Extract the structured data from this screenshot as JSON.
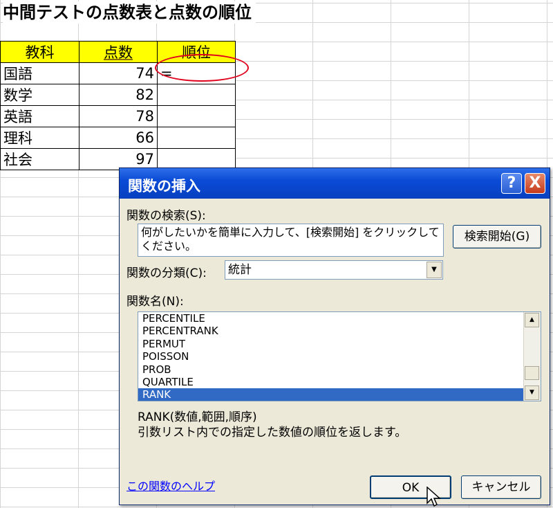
{
  "sheet": {
    "title": "中間テストの点数表と点数の順位",
    "headers": [
      "教科",
      "点数",
      "順位"
    ],
    "rows": [
      {
        "subject": "国語",
        "score": "74",
        "rank": "="
      },
      {
        "subject": "数学",
        "score": "82",
        "rank": ""
      },
      {
        "subject": "英語",
        "score": "78",
        "rank": ""
      },
      {
        "subject": "理科",
        "score": "66",
        "rank": ""
      },
      {
        "subject": "社会",
        "score": "97",
        "rank": ""
      }
    ]
  },
  "dialog": {
    "title": "関数の挿入",
    "help_button": "?",
    "close_button": "X",
    "search_label": "関数の検索(S):",
    "search_text": "何がしたいかを簡単に入力して、[検索開始] をクリックしてください。",
    "search_button": "検索開始(G)",
    "category_label": "関数の分類(C):",
    "category_value": "統計",
    "names_label": "関数名(N):",
    "functions": [
      "PERCENTILE",
      "PERCENTRANK",
      "PERMUT",
      "POISSON",
      "PROB",
      "QUARTILE",
      "RANK"
    ],
    "selected_function": "RANK",
    "syntax": "RANK(数値,範囲,順序)",
    "description": "引数リスト内での指定した数値の順位を返します。",
    "help_link": "この関数のヘルプ",
    "ok_button": "OK",
    "cancel_button": "キャンセル"
  },
  "colors": {
    "header_fill": "#ffff00",
    "highlight_ellipse": "#e0001b",
    "titlebar": "#0a4bd6",
    "selection": "#316ac5",
    "link": "#0000ff"
  }
}
